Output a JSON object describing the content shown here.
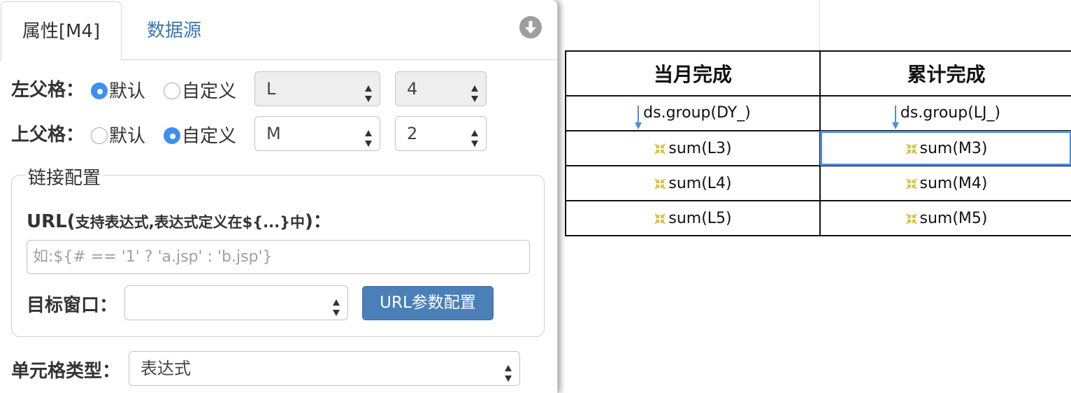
{
  "panel": {
    "tabs": [
      {
        "label": "属性[M4]",
        "active": true
      },
      {
        "label": "数据源",
        "active": false
      }
    ],
    "left_parent": {
      "label": "左父格：",
      "options": [
        "默认",
        "自定义"
      ],
      "selected": "默认",
      "column_value": "L",
      "row_value": "4"
    },
    "top_parent": {
      "label": "上父格：",
      "options": [
        "默认",
        "自定义"
      ],
      "selected": "自定义",
      "column_value": "M",
      "row_value": "2"
    },
    "link_config": {
      "legend": "链接配置",
      "url_label_main": "URL(",
      "url_label_hint": "支持表达式,表达式定义在${...}中",
      "url_label_end": ")：",
      "url_placeholder": "如:${# == '1' ? 'a.jsp' : 'b.jsp'}",
      "url_value": "",
      "target_label": "目标窗口：",
      "target_value": "",
      "params_button": "URL参数配置"
    },
    "cell_type": {
      "label": "单元格类型：",
      "value": "表达式"
    }
  },
  "sheet": {
    "header": [
      "当月完成",
      "累计完成"
    ],
    "rows": [
      [
        "ds.group(DY_)",
        "ds.group(LJ_)"
      ],
      [
        "sum(L3)",
        "sum(M3)"
      ],
      [
        "sum(L4)",
        "sum(M4)"
      ],
      [
        "sum(L5)",
        "sum(M5)"
      ]
    ]
  },
  "colors": {
    "tab_link": "#3a77b7",
    "radio_on": "#3d8ff0",
    "primary_button": "#4a7fb8",
    "selection": "#4a8fe0",
    "expand_arrow": "#4a90d9",
    "aggregate_icon": "#d4c34a"
  },
  "icons": {
    "collapse": "circle-down-arrow-icon",
    "expand": "down-arrow-icon",
    "aggregate": "collapse-arrows-icon",
    "select": "up-down-arrows-icon"
  }
}
